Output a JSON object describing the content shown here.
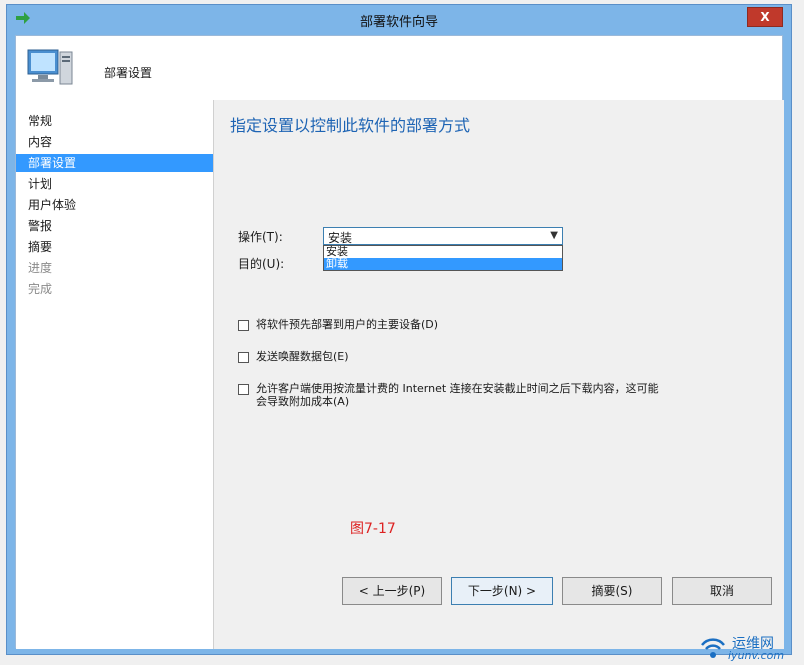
{
  "window": {
    "title": "部署软件向导",
    "close_label": "X"
  },
  "header": {
    "title": "部署设置"
  },
  "sidebar": {
    "items": [
      {
        "label": "常规",
        "state": "normal"
      },
      {
        "label": "内容",
        "state": "normal"
      },
      {
        "label": "部署设置",
        "state": "selected"
      },
      {
        "label": "计划",
        "state": "normal"
      },
      {
        "label": "用户体验",
        "state": "normal"
      },
      {
        "label": "警报",
        "state": "normal"
      },
      {
        "label": "摘要",
        "state": "normal"
      },
      {
        "label": "进度",
        "state": "disabled"
      },
      {
        "label": "完成",
        "state": "disabled"
      }
    ]
  },
  "content": {
    "heading": "指定设置以控制此软件的部署方式",
    "action_label": "操作(T):",
    "purpose_label": "目的(U):",
    "action_select": {
      "value": "安装",
      "options": [
        "安装",
        "卸载"
      ],
      "highlighted": "卸载"
    },
    "checkboxes": [
      {
        "label": "将软件预先部署到用户的主要设备(D)",
        "checked": false
      },
      {
        "label": "发送唤醒数据包(E)",
        "checked": false
      },
      {
        "label": "允许客户端使用按流量计费的 Internet 连接在安装截止时间之后下载内容，这可能会导致附加成本(A)",
        "checked": false
      }
    ],
    "caption": "图7-17"
  },
  "footer": {
    "prev_label": "< 上一步(P)",
    "next_label": "下一步(N) >",
    "summary_label": "摘要(S)",
    "cancel_label": "取消"
  },
  "watermark": {
    "name": "运维网",
    "url_text": "iyunv.com"
  },
  "colors": {
    "accent": "#3399ff",
    "heading": "#1e64b4",
    "window_frame": "#7db5e8",
    "caption": "#dd2222"
  }
}
